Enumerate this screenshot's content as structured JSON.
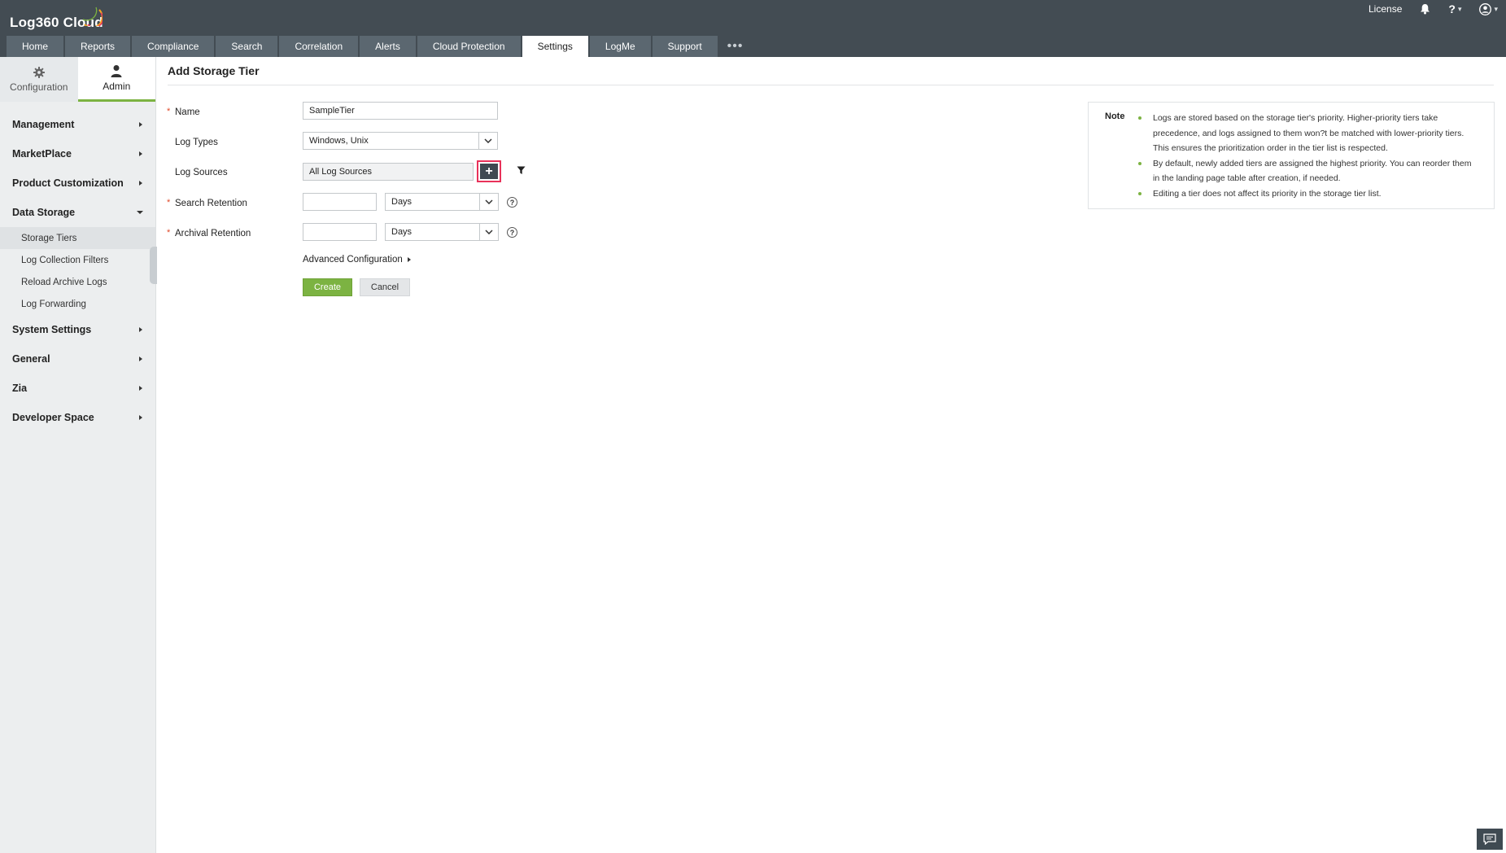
{
  "header": {
    "logo_text": "Log360 Cloud",
    "license_label": "License",
    "help_label": "?"
  },
  "nav": {
    "tabs": [
      {
        "label": "Home"
      },
      {
        "label": "Reports"
      },
      {
        "label": "Compliance"
      },
      {
        "label": "Search"
      },
      {
        "label": "Correlation"
      },
      {
        "label": "Alerts"
      },
      {
        "label": "Cloud Protection"
      },
      {
        "label": "Settings",
        "active": true
      },
      {
        "label": "LogMe"
      },
      {
        "label": "Support"
      }
    ],
    "more_label": "•••"
  },
  "sidebar": {
    "mode_tabs": {
      "configuration": "Configuration",
      "admin": "Admin"
    },
    "groups": {
      "management": "Management",
      "marketplace": "MarketPlace",
      "product_customization": "Product Customization",
      "data_storage": "Data Storage",
      "system_settings": "System Settings",
      "general": "General",
      "zia": "Zia",
      "developer_space": "Developer Space"
    },
    "data_storage_items": {
      "storage_tiers": "Storage Tiers",
      "log_collection_filters": "Log Collection Filters",
      "reload_archive_logs": "Reload Archive Logs",
      "log_forwarding": "Log Forwarding"
    }
  },
  "form": {
    "title": "Add Storage Tier",
    "required_mark": "*",
    "name_label": "Name",
    "name_value": "SampleTier",
    "log_types_label": "Log Types",
    "log_types_value": "Windows, Unix",
    "log_sources_label": "Log Sources",
    "log_sources_value": "All Log Sources",
    "add_symbol": "+",
    "search_retention_label": "Search Retention",
    "search_retention_unit": "Days",
    "archival_retention_label": "Archival Retention",
    "archival_retention_unit": "Days",
    "help_symbol": "?",
    "advanced_label": "Advanced Configuration",
    "create_label": "Create",
    "cancel_label": "Cancel"
  },
  "note": {
    "title": "Note",
    "items": [
      "Logs are stored based on the storage tier's priority. Higher-priority tiers take precedence, and logs assigned to them won?t be matched with lower-priority tiers. This ensures the prioritization order in the tier list is respected.",
      "By default, newly added tiers are assigned the highest priority. You can reorder them in the landing page table after creation, if needed.",
      "Editing a tier does not affect its priority in the storage tier list."
    ]
  },
  "colors": {
    "header_bg": "#434c53",
    "tab_bg": "#5b6770",
    "accent_green": "#7cb342",
    "highlight_red": "#e8325a"
  }
}
